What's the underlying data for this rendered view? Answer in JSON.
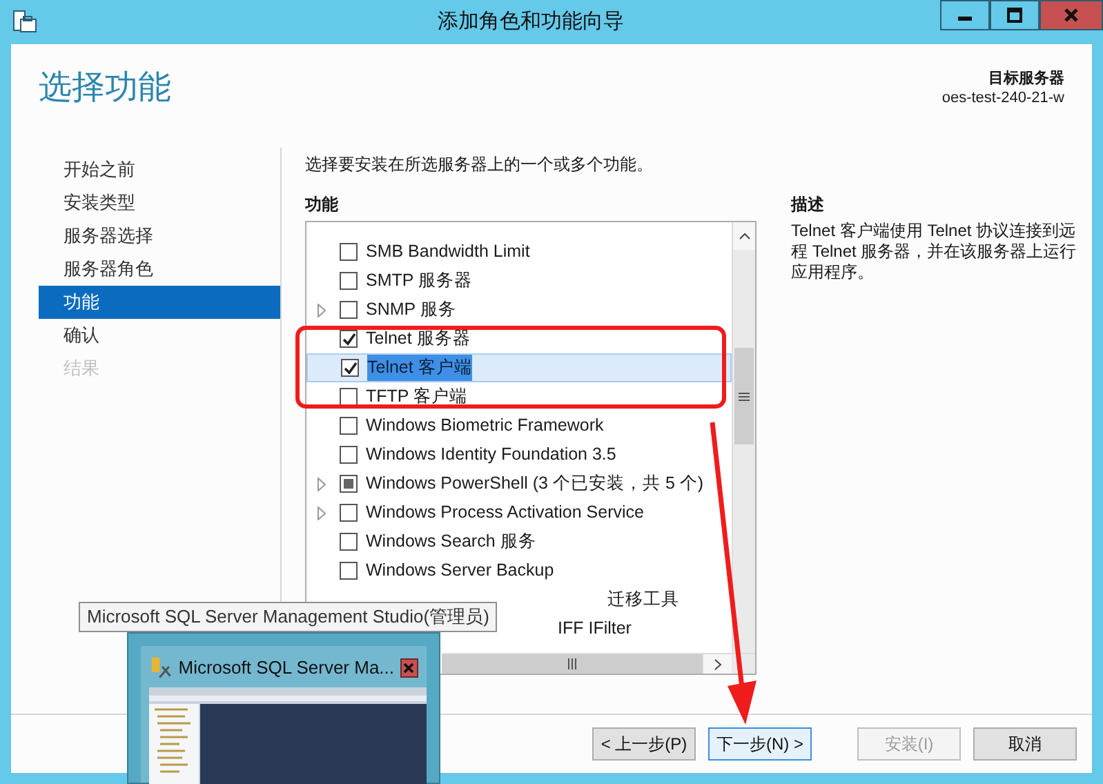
{
  "window": {
    "title": "添加角色和功能向导"
  },
  "page_title": "选择功能",
  "target_server": {
    "label": "目标服务器",
    "name": "oes-test-240-21-w"
  },
  "steps": [
    {
      "label": "开始之前",
      "selected": false,
      "disabled": false
    },
    {
      "label": "安装类型",
      "selected": false,
      "disabled": false
    },
    {
      "label": "服务器选择",
      "selected": false,
      "disabled": false
    },
    {
      "label": "服务器角色",
      "selected": false,
      "disabled": false
    },
    {
      "label": "功能",
      "selected": true,
      "disabled": false
    },
    {
      "label": "确认",
      "selected": false,
      "disabled": false
    },
    {
      "label": "结果",
      "selected": false,
      "disabled": true
    }
  ],
  "instruction": "选择要安装在所选服务器上的一个或多个功能。",
  "features": {
    "heading": "功能",
    "items": [
      {
        "kind": "item",
        "label": "SMB Bandwidth Limit",
        "checked": false,
        "indeterminate": false,
        "expandable": false,
        "selected": false
      },
      {
        "kind": "item",
        "label": "SMTP 服务器",
        "checked": false,
        "indeterminate": false,
        "expandable": false,
        "selected": false
      },
      {
        "kind": "item",
        "label": "SNMP 服务",
        "checked": false,
        "indeterminate": false,
        "expandable": true,
        "selected": false
      },
      {
        "kind": "item",
        "label": "Telnet 服务器",
        "checked": true,
        "indeterminate": false,
        "expandable": false,
        "selected": false
      },
      {
        "kind": "item",
        "label": "Telnet 客户端",
        "checked": true,
        "indeterminate": false,
        "expandable": false,
        "selected": true
      },
      {
        "kind": "item",
        "label": "TFTP 客户端",
        "checked": false,
        "indeterminate": false,
        "expandable": false,
        "selected": false
      },
      {
        "kind": "item",
        "label": "Windows Biometric Framework",
        "checked": false,
        "indeterminate": false,
        "expandable": false,
        "selected": false
      },
      {
        "kind": "item",
        "label": "Windows Identity Foundation 3.5",
        "checked": false,
        "indeterminate": false,
        "expandable": false,
        "selected": false
      },
      {
        "kind": "item",
        "label": "Windows PowerShell (3 个已安装，共 5 个)",
        "checked": false,
        "indeterminate": true,
        "expandable": true,
        "selected": false
      },
      {
        "kind": "item",
        "label": "Windows Process Activation Service",
        "checked": false,
        "indeterminate": false,
        "expandable": true,
        "selected": false
      },
      {
        "kind": "item",
        "label": "Windows Search 服务",
        "checked": false,
        "indeterminate": false,
        "expandable": false,
        "selected": false
      },
      {
        "kind": "item",
        "label": "Windows Server Backup",
        "checked": false,
        "indeterminate": false,
        "expandable": false,
        "selected": false
      },
      {
        "kind": "covered",
        "label": "迁移工具"
      },
      {
        "kind": "covered",
        "label": "IFF IFilter"
      }
    ]
  },
  "description": {
    "heading": "描述",
    "text": "Telnet 客户端使用 Telnet 协议连接到远程 Telnet 服务器，并在该服务器上运行应用程序。"
  },
  "buttons": [
    {
      "label": "< 上一步(P)",
      "disabled": false,
      "focused": false
    },
    {
      "label": "下一步(N) >",
      "disabled": false,
      "focused": true
    },
    {
      "label": "安装(I)",
      "disabled": true,
      "focused": false
    },
    {
      "label": "取消",
      "disabled": false,
      "focused": false
    }
  ],
  "taskbar_preview": {
    "tooltip": "Microsoft SQL Server Management Studio(管理员)",
    "title": "Microsoft SQL Server Ma..."
  }
}
